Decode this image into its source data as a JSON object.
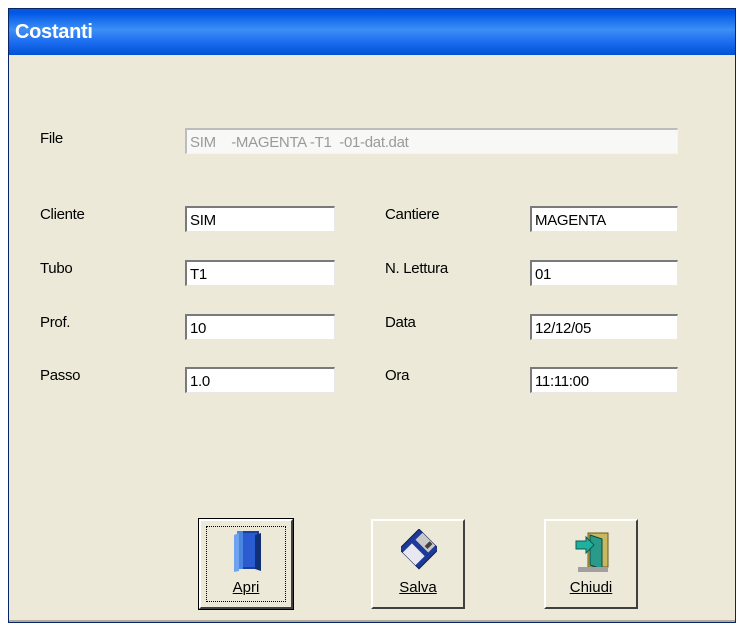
{
  "window": {
    "title": "Costanti"
  },
  "file": {
    "label": "File",
    "value": "SIM    -MAGENTA -T1  -01-dat.dat"
  },
  "fields": {
    "cliente": {
      "label": "Cliente",
      "value": "SIM"
    },
    "tubo": {
      "label": "Tubo",
      "value": "T1"
    },
    "prof": {
      "label": "Prof.",
      "value": "10"
    },
    "passo": {
      "label": "Passo",
      "value": "1.0"
    },
    "cantiere": {
      "label": "Cantiere",
      "value": "MAGENTA"
    },
    "lettura": {
      "label": "N. Lettura",
      "value": "01"
    },
    "data": {
      "label": "Data",
      "value": "12/12/05"
    },
    "ora": {
      "label": "Ora",
      "value": "11:11:00"
    }
  },
  "buttons": {
    "apri": {
      "label": "Apri",
      "icon": "book-icon"
    },
    "salva": {
      "label": "Salva",
      "icon": "floppy-disk-icon"
    },
    "chiudi": {
      "label": "Chiudi",
      "icon": "exit-door-icon"
    }
  },
  "colors": {
    "titlebar": "#0058e6",
    "window_bg": "#ece9d8"
  }
}
